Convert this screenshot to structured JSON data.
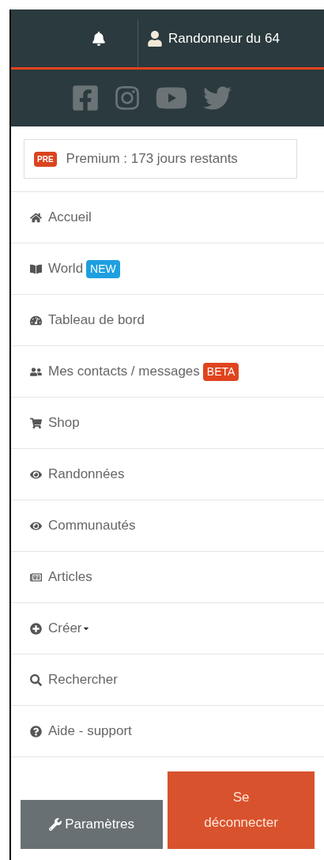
{
  "header": {
    "user_name": "Randonneur du 64"
  },
  "premium": {
    "badge": "PRE",
    "text": "Premium : 173 jours restants"
  },
  "menu": [
    {
      "label": "Accueil",
      "caret": false
    },
    {
      "label": "World",
      "caret": false,
      "badge": {
        "text": "NEW",
        "color": "#1e9fe0"
      }
    },
    {
      "label": "Tableau de bord",
      "caret": false
    },
    {
      "label": "Mes contacts / messages",
      "caret": false,
      "badge": {
        "text": "BETA",
        "color": "#e0441e"
      }
    },
    {
      "label": "Shop",
      "caret": false
    },
    {
      "label": "Randonnées",
      "caret": false
    },
    {
      "label": "Communautés",
      "caret": false
    },
    {
      "label": "Articles",
      "caret": false
    },
    {
      "label": "Créer",
      "caret": true
    },
    {
      "label": "Rechercher",
      "caret": false
    },
    {
      "label": "Aide - support",
      "caret": false
    }
  ],
  "buttons": {
    "settings": "Paramètres",
    "logout": "Se déconnecter"
  }
}
